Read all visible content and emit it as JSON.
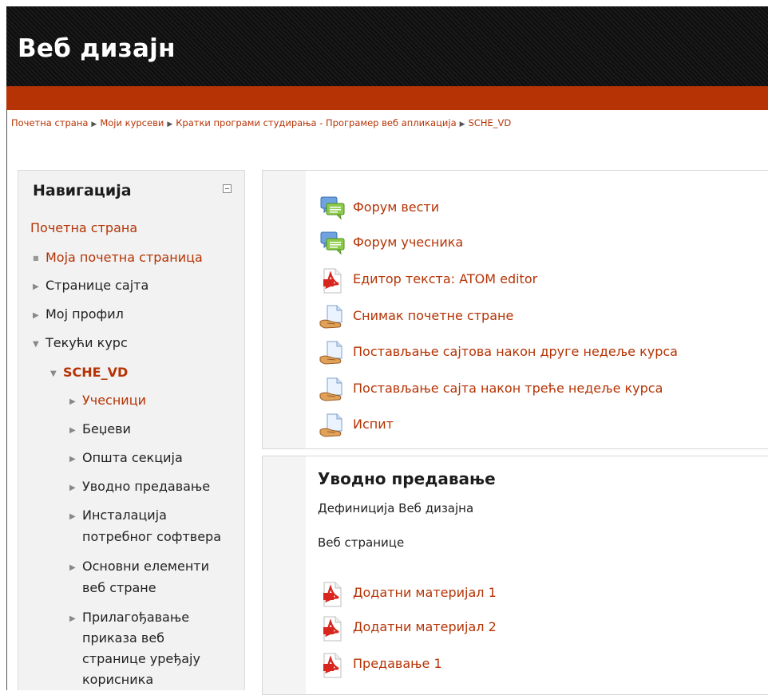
{
  "site": {
    "title": "Веб дизајн"
  },
  "breadcrumb": [
    "Почетна страна",
    "Моји курсеви",
    "Кратки програми студирања - Програмер веб апликација",
    "SCHE_VD"
  ],
  "navigation": {
    "title": "Навигација",
    "home": "Почетна страна",
    "my_home": "Моја почетна страница",
    "site_pages": "Странице сајта",
    "my_profile": "Мој профил",
    "current_course": "Текући курс",
    "course": "SCHE_VD",
    "participants": "Учесници",
    "badges": "Беџеви",
    "general_section": "Општа секција",
    "intro_lecture": "Уводно предавање",
    "install_l1": "Инсталација",
    "install_l2": "потребног софтвера",
    "basics_l1": "Основни елементи",
    "basics_l2": "веб стране",
    "adapt_l1": "Прилагођавање",
    "adapt_l2": "приказа веб",
    "adapt_l3": "странице уређају",
    "adapt_l4": "корисника"
  },
  "section0": {
    "activities": [
      {
        "label": "Форум вести",
        "icon": "forum-icon"
      },
      {
        "label": "Форум учесника",
        "icon": "forum-icon"
      },
      {
        "label": "Едитор текста: ATOM editor",
        "icon": "pdf-icon"
      },
      {
        "label": "Снимак почетне стране",
        "icon": "assignment-icon"
      },
      {
        "label": "Постављање сајтова након друге недеље курса",
        "icon": "assignment-icon"
      },
      {
        "label": "Постављање сајта након треће недеље курса",
        "icon": "assignment-icon"
      },
      {
        "label": "Испит",
        "icon": "assignment-icon"
      }
    ]
  },
  "section1": {
    "title": "Уводно предавање",
    "line1": "Дефиниција Веб дизајна",
    "line2": "Веб странице",
    "resources": [
      {
        "label": "Додатни материјал 1",
        "icon": "pdf-icon"
      },
      {
        "label": "Додатни материјал 2",
        "icon": "pdf-icon"
      },
      {
        "label": "Предавање 1",
        "icon": "pdf-icon"
      }
    ]
  },
  "colors": {
    "accent": "#b53304",
    "header": "#121212"
  }
}
